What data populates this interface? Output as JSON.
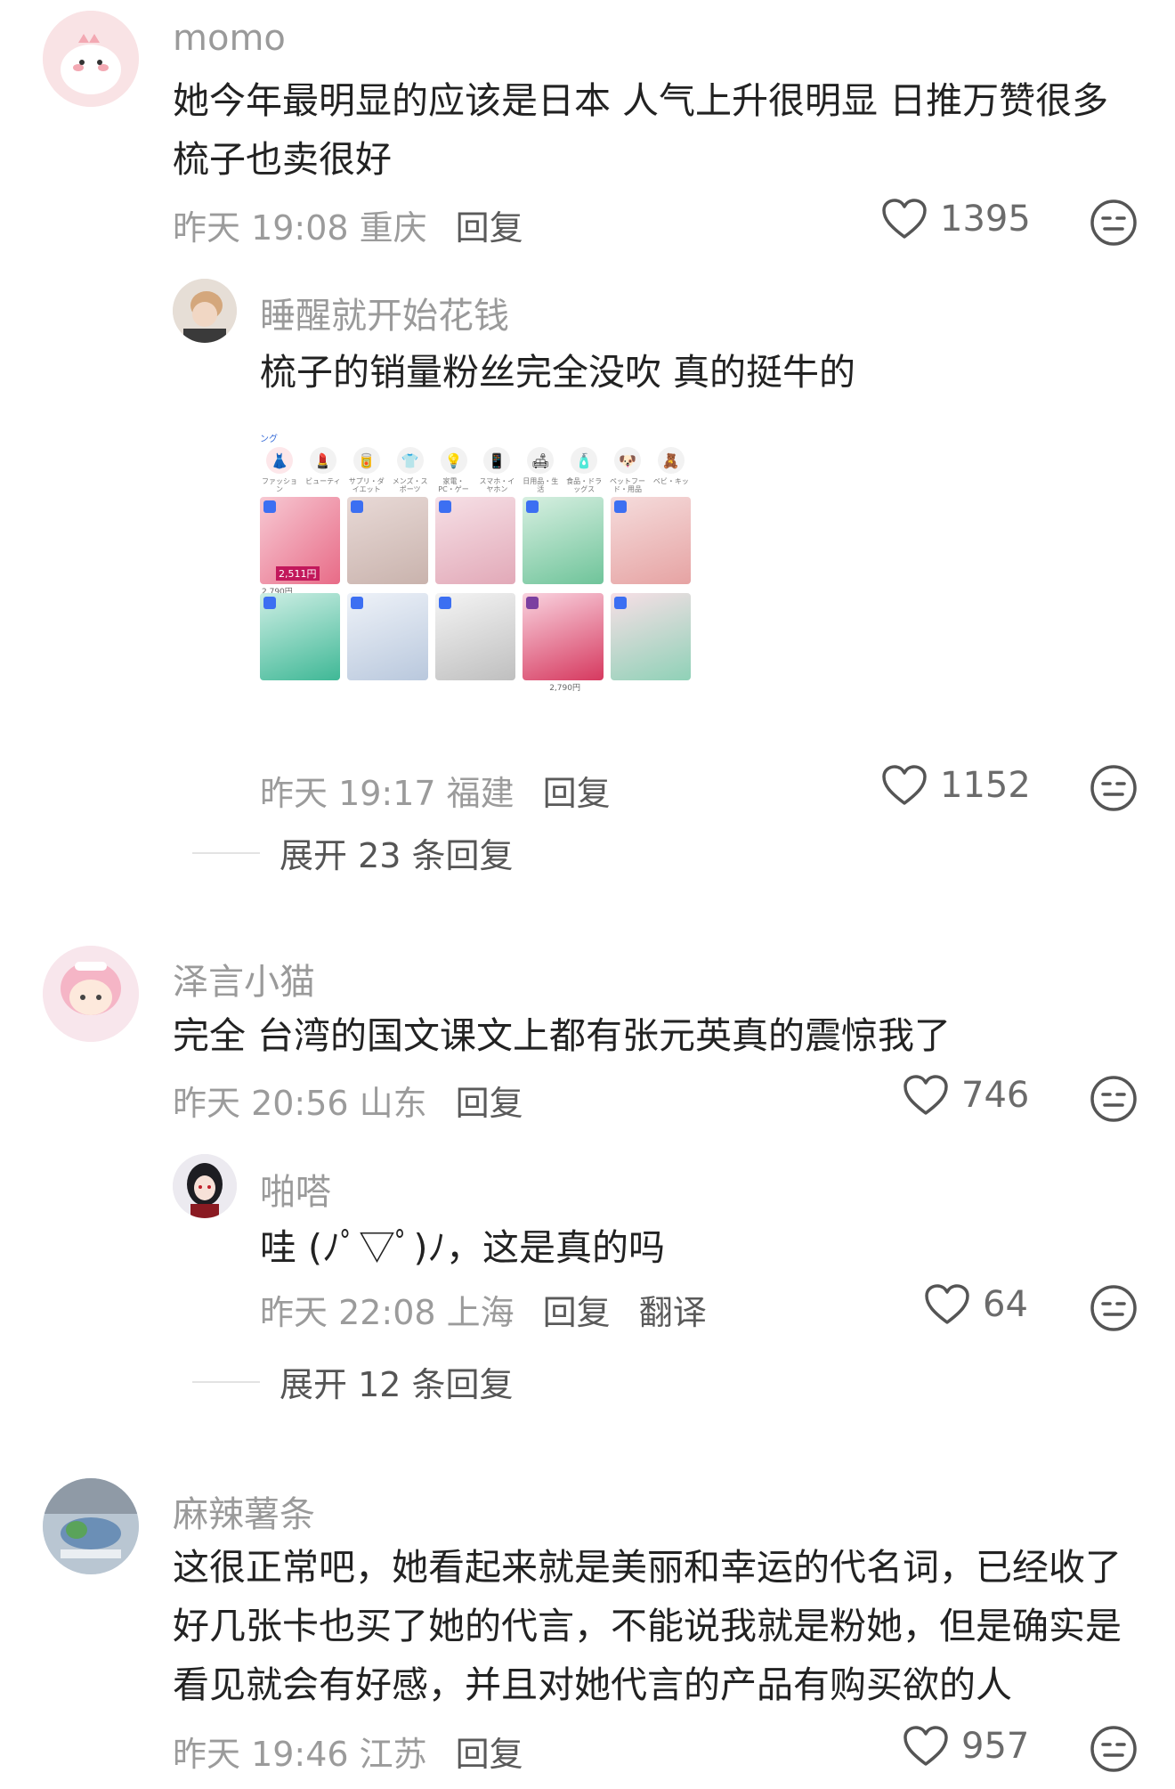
{
  "comments": [
    {
      "user": "momo",
      "text": "她今年最明显的应该是日本 人气上升很明显 日推万赞很多梳子也卖很好",
      "time": "昨天 19:08 重庆",
      "reply_label": "回复",
      "likes": "1395",
      "avatar_color": "#f7d9dc",
      "replies": [
        {
          "user": "睡醒就开始花钱",
          "text": "梳子的销量粉丝完全没吹 真的挺牛的",
          "time": "昨天 19:17 福建",
          "reply_label": "回复",
          "likes": "1152",
          "screenshot": {
            "header": "ング",
            "categories": [
              "ファッション",
              "ビューティ",
              "サプリ・ダイエット",
              "メンズ・スポーツ",
              "家電・PC・ゲーム",
              "スマホ・イヤホン",
              "日用品・生活",
              "食品・ドラッグス",
              "ペットフード・用品",
              "ベビ・キッ"
            ],
            "price_a": "2,511円",
            "price_b": "2,790円",
            "price_c": "2,790円"
          }
        }
      ],
      "expand_label": "展开 23 条回复"
    },
    {
      "user": "泽言小猫",
      "text": "完全 台湾的国文课文上都有张元英真的震惊我了",
      "time": "昨天 20:56 山东",
      "reply_label": "回复",
      "likes": "746",
      "avatar_color": "#f6dfe6",
      "replies": [
        {
          "user": "啪嗒",
          "text": "哇 (ﾉﾟ▽ﾟ)ﾉ，这是真的吗",
          "time": "昨天 22:08 上海",
          "reply_label": "回复",
          "translate_label": "翻译",
          "likes": "64"
        }
      ],
      "expand_label": "展开 12 条回复"
    },
    {
      "user": "麻辣薯条",
      "text": "这很正常吧，她看起来就是美丽和幸运的代名词，已经收了好几张卡也买了她的代言，不能说我就是粉她，但是确实是看见就会有好感，并且对她代言的产品有购买欲的人",
      "time": "昨天 19:46 江苏",
      "reply_label": "回复",
      "likes": "957",
      "avatar_color": "#c9d4e0"
    }
  ],
  "icons": {
    "like": "heart-outline-icon",
    "dislike": "meh-face-icon"
  }
}
